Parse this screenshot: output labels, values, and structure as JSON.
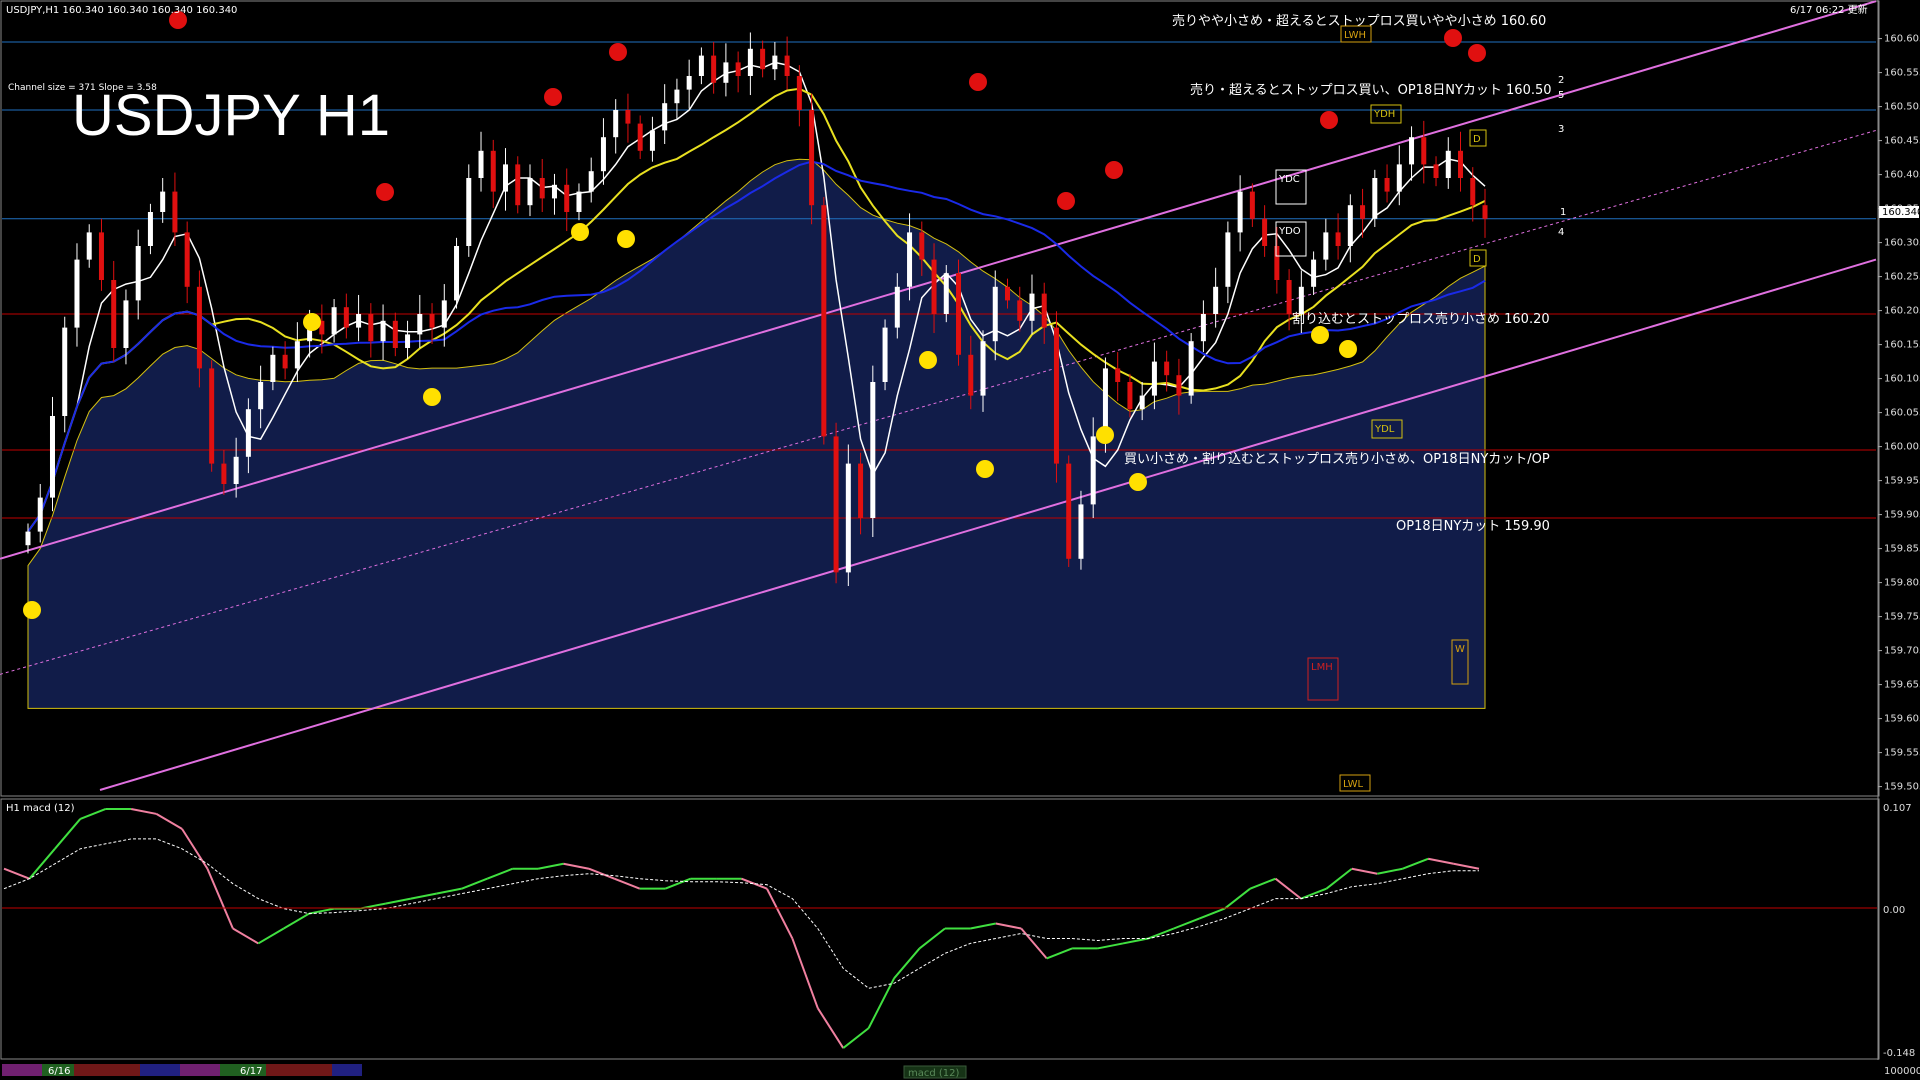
{
  "header": {
    "symbol_info": "USDJPY,H1  160.340 160.340 160.340 160.340",
    "channel_info": "Channel size = 371 Slope = 3.58",
    "title": "USDJPY H1",
    "datetime": "6/17 06:22 更新"
  },
  "annotations": [
    {
      "text": "売りやや小さめ・超えるとストップロス買いやや小さめ 160.60",
      "price": 160.6
    },
    {
      "text": "売り・超えるとストップロス買い、OP18日NYカット 160.50",
      "price": 160.5
    },
    {
      "text": "割り込むとストップロス売り小さめ 160.20",
      "price": 160.2
    },
    {
      "text": "買い小さめ・割り込むとストップロス売り小さめ、OP18日NYカット/OP",
      "price": 160.0
    },
    {
      "text": "OP18日NYカット 159.90",
      "price": 159.9
    }
  ],
  "level_boxes": [
    {
      "label": "LWH",
      "color": "#d4a010"
    },
    {
      "label": "YDH",
      "color": "#d4c010"
    },
    {
      "label": "YDC",
      "color": "#ffffff"
    },
    {
      "label": "YDO",
      "color": "#ffffff"
    },
    {
      "label": "YDL",
      "color": "#d4c010"
    },
    {
      "label": "LMH",
      "color": "#d02020"
    },
    {
      "label": "LWL",
      "color": "#d4a010"
    },
    {
      "label": "W",
      "color": "#d4a010"
    },
    {
      "label": "D",
      "color": "#d4c010"
    },
    {
      "label": "D",
      "color": "#d4c010"
    }
  ],
  "channel_markers": [
    "1",
    "2",
    "3",
    "4",
    "5"
  ],
  "macd_panel": {
    "label": "H1  macd (12)",
    "axis_labels": [
      "0.107",
      "0.00",
      "-0.148"
    ],
    "footer_box": "macd (12)",
    "bottom_right": "100000"
  },
  "date_labels": [
    "6/16",
    "6/17"
  ],
  "current_price_label": "160.340",
  "colors": {
    "bullish_candle": "#ffffff",
    "bearish_candle": "#e01010",
    "ma_yellow": "#e8e020",
    "ma_blue": "#1a2ae8",
    "ma_white": "#ffffff",
    "channel": "#e070e0",
    "cloud": "#3050d0",
    "macd_up": "#40e040",
    "macd_down": "#f080a0",
    "signal": "#ffffff",
    "hline_red": "#c00000",
    "hline_blue": "#2070c0"
  },
  "chart_data": {
    "type": "candlestick",
    "timeframe": "H1",
    "symbol": "USDJPY",
    "ylim": [
      159.5,
      160.65
    ],
    "y_ticks": [
      160.605,
      160.555,
      160.505,
      160.455,
      160.405,
      160.355,
      160.305,
      160.255,
      160.205,
      160.155,
      160.105,
      160.055,
      160.005,
      159.955,
      159.905,
      159.855,
      159.805,
      159.755,
      159.705,
      159.655,
      159.605,
      159.555,
      159.505
    ],
    "hlines": [
      {
        "price": 160.6,
        "color": "hline_blue"
      },
      {
        "price": 160.5,
        "color": "hline_blue"
      },
      {
        "price": 160.34,
        "color": "hline_blue"
      },
      {
        "price": 160.2,
        "color": "hline_red"
      },
      {
        "price": 160.0,
        "color": "hline_red"
      },
      {
        "price": 159.9,
        "color": "hline_red"
      }
    ],
    "closes": [
      159.88,
      159.93,
      160.05,
      160.18,
      160.28,
      160.32,
      160.25,
      160.15,
      160.22,
      160.3,
      160.35,
      160.38,
      160.32,
      160.24,
      160.12,
      159.98,
      159.95,
      159.99,
      160.06,
      160.1,
      160.14,
      160.12,
      160.16,
      160.19,
      160.17,
      160.21,
      160.18,
      160.2,
      160.16,
      160.19,
      160.15,
      160.17,
      160.2,
      160.18,
      160.22,
      160.3,
      160.4,
      160.44,
      160.38,
      160.42,
      160.36,
      160.4,
      160.37,
      160.39,
      160.35,
      160.38,
      160.41,
      160.46,
      160.5,
      160.48,
      160.44,
      160.47,
      160.51,
      160.53,
      160.55,
      160.58,
      160.54,
      160.57,
      160.55,
      160.59,
      160.56,
      160.58,
      160.55,
      160.5,
      160.36,
      160.02,
      159.82,
      159.98,
      159.9,
      160.1,
      160.18,
      160.24,
      160.32,
      160.28,
      160.2,
      160.26,
      160.14,
      160.08,
      160.16,
      160.24,
      160.22,
      160.19,
      160.23,
      160.18,
      159.98,
      159.84,
      159.92,
      160.02,
      160.12,
      160.1,
      160.06,
      160.08,
      160.13,
      160.11,
      160.08,
      160.16,
      160.2,
      160.24,
      160.32,
      160.38,
      160.34,
      160.3,
      160.25,
      160.2,
      160.24,
      160.28,
      160.32,
      160.3,
      160.36,
      160.34,
      160.4,
      160.38,
      160.42,
      160.46,
      160.42,
      160.4,
      160.44,
      160.4,
      160.36,
      160.34
    ],
    "closes_note": "",
    "macd": [
      0.04,
      0.03,
      0.06,
      0.09,
      0.1,
      0.1,
      0.095,
      0.08,
      0.04,
      -0.02,
      -0.035,
      -0.02,
      -0.005,
      0.0,
      0.0,
      0.005,
      0.01,
      0.015,
      0.02,
      0.03,
      0.04,
      0.04,
      0.045,
      0.04,
      0.03,
      0.02,
      0.02,
      0.03,
      0.03,
      0.03,
      0.02,
      -0.03,
      -0.1,
      -0.14,
      -0.12,
      -0.07,
      -0.04,
      -0.02,
      -0.02,
      -0.015,
      -0.02,
      -0.05,
      -0.04,
      -0.04,
      -0.035,
      -0.03,
      -0.02,
      -0.01,
      0.0,
      0.02,
      0.03,
      0.01,
      0.02,
      0.04,
      0.035,
      0.04,
      0.05,
      0.045,
      0.04
    ],
    "signal": [
      0.02,
      0.03,
      0.045,
      0.06,
      0.065,
      0.07,
      0.07,
      0.06,
      0.045,
      0.025,
      0.01,
      0.0,
      -0.005,
      -0.004,
      -0.002,
      0.0,
      0.005,
      0.01,
      0.015,
      0.02,
      0.025,
      0.03,
      0.033,
      0.035,
      0.033,
      0.03,
      0.028,
      0.027,
      0.027,
      0.026,
      0.024,
      0.01,
      -0.02,
      -0.06,
      -0.08,
      -0.075,
      -0.06,
      -0.045,
      -0.035,
      -0.03,
      -0.025,
      -0.03,
      -0.03,
      -0.032,
      -0.03,
      -0.03,
      -0.025,
      -0.018,
      -0.01,
      0.0,
      0.01,
      0.01,
      0.015,
      0.022,
      0.025,
      0.03,
      0.035,
      0.038,
      0.038
    ]
  }
}
